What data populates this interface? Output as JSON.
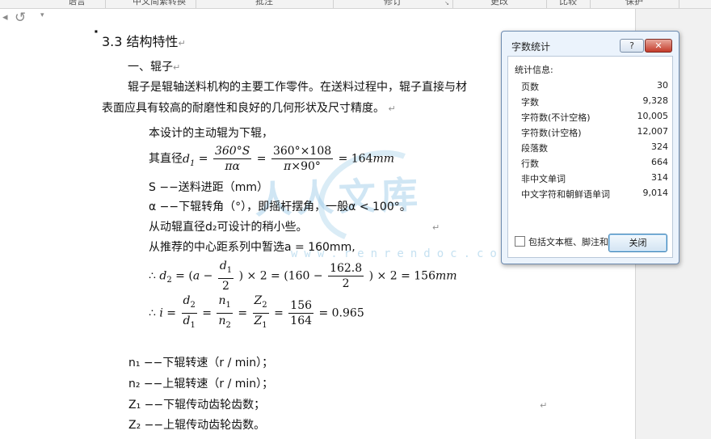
{
  "ribbon": {
    "groups": [
      "语言",
      "中文简繁转换",
      "批注",
      "修订",
      "更改",
      "比较",
      "保护"
    ]
  },
  "quick_access": {
    "undo_icon": "undo-arrow-icon",
    "redo_icon": "redo-arrow-icon",
    "customize_icon": "chevron-down-icon"
  },
  "document": {
    "section_title": "3.3  结构特性",
    "subsection": "一、辊子",
    "para1_line1": "辊子是辊轴送料机构的主要工作零件。在送料过程中，辊子直接与材",
    "para1_line2": "表面应具有较高的耐磨性和良好的几何形状及尺寸精度。",
    "line_driver": "本设计的主动辊为下辊，",
    "diameter_prefix": "其直径",
    "diameter_result": "= 164",
    "unit_mm": "mm",
    "s_def": "S −−送料进距（mm）",
    "alpha_def": "α −−下辊转角（°），即摇杆摆角，一般α < 100°。",
    "d2_note": "从动辊直径d₂可设计的稍小些。",
    "center_dist": "从推荐的中心距系列中暂选a = 160mm,",
    "d2_eq_result": "× 2 = 156",
    "i_eq_result": "= 0.965",
    "n1_def": "n₁ −−下辊转速（r / min）；",
    "n2_def": "n₂ −−上辊转速（r / min）；",
    "z1_def": "Z₁ −−下辊传动齿轮齿数；",
    "z2_def": "Z₂ −−上辊传动齿轮齿数。"
  },
  "watermark": {
    "text": "人人文库",
    "url": "www.renrendoc.com"
  },
  "dialog": {
    "title": "字数统计",
    "help_label": "?",
    "close_label": "✕",
    "heading": "统计信息:",
    "stats": [
      {
        "label": "页数",
        "value": "30"
      },
      {
        "label": "字数",
        "value": "9,328"
      },
      {
        "label": "字符数(不计空格)",
        "value": "10,005"
      },
      {
        "label": "字符数(计空格)",
        "value": "12,007"
      },
      {
        "label": "段落数",
        "value": "324"
      },
      {
        "label": "行数",
        "value": "664"
      },
      {
        "label": "非中文单词",
        "value": "314"
      },
      {
        "label": "中文字符和朝鲜语单词",
        "value": "9,014"
      }
    ],
    "checkbox_label": "包括文本框、脚注和尾注(F)",
    "checkbox_checked": false,
    "close_button": "关闭"
  }
}
